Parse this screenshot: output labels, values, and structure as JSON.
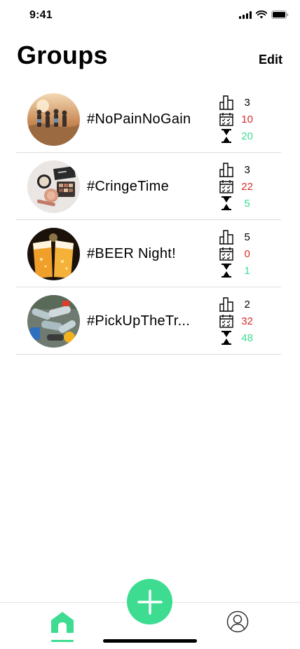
{
  "status_bar": {
    "time": "9:41"
  },
  "header": {
    "title": "Groups",
    "edit_label": "Edit"
  },
  "groups": [
    {
      "name": "#NoPainNoGain",
      "members": "3",
      "days": "10",
      "time": "20",
      "photo": "desert-hikers"
    },
    {
      "name": "#CringeTime",
      "members": "3",
      "days": "22",
      "time": "5",
      "photo": "makeup-palette"
    },
    {
      "name": "#BEER Night!",
      "members": "5",
      "days": "0",
      "time": "1",
      "photo": "beer-glasses"
    },
    {
      "name": "#PickUpTheTr...",
      "members": "2",
      "days": "32",
      "time": "48",
      "photo": "plastic-bottles"
    }
  ],
  "colors": {
    "accent": "#3ddc91",
    "days": "#d62b2b",
    "time": "#3ddc91"
  },
  "tab_bar": {
    "items": [
      "home-icon",
      "add-icon",
      "profile-icon"
    ],
    "active": "home"
  }
}
